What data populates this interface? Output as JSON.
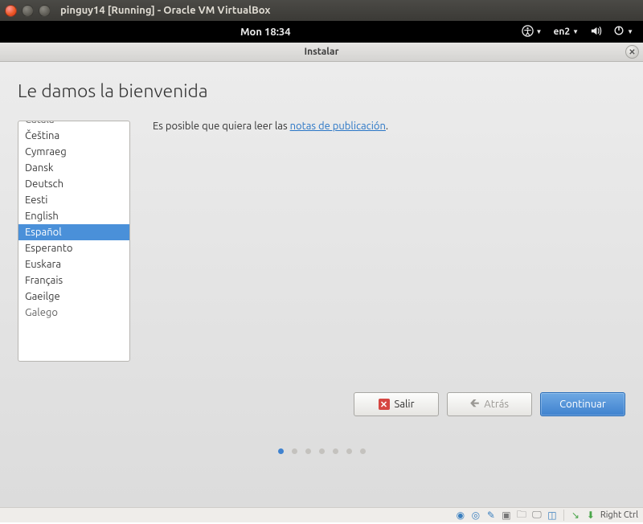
{
  "host": {
    "title": "pinguy14 [Running] - Oracle VM VirtualBox",
    "status": {
      "right_ctrl": "Right Ctrl"
    }
  },
  "guest_topbar": {
    "clock": "Mon 18:34",
    "input_source": "en2"
  },
  "installer": {
    "window_title": "Instalar",
    "page_title": "Le damos la bienvenida",
    "intro_prefix": "Es posible que quiera leer las ",
    "intro_link": "notas de publicación",
    "intro_suffix": ".",
    "languages": [
      "Català",
      "Čeština",
      "Cymraeg",
      "Dansk",
      "Deutsch",
      "Eesti",
      "English",
      "Español",
      "Esperanto",
      "Euskara",
      "Français",
      "Gaeilge",
      "Galego"
    ],
    "selected_language": "Español",
    "buttons": {
      "quit": "Salir",
      "back": "Atrás",
      "continue": "Continuar"
    },
    "step_count": 7,
    "active_step": 0
  }
}
